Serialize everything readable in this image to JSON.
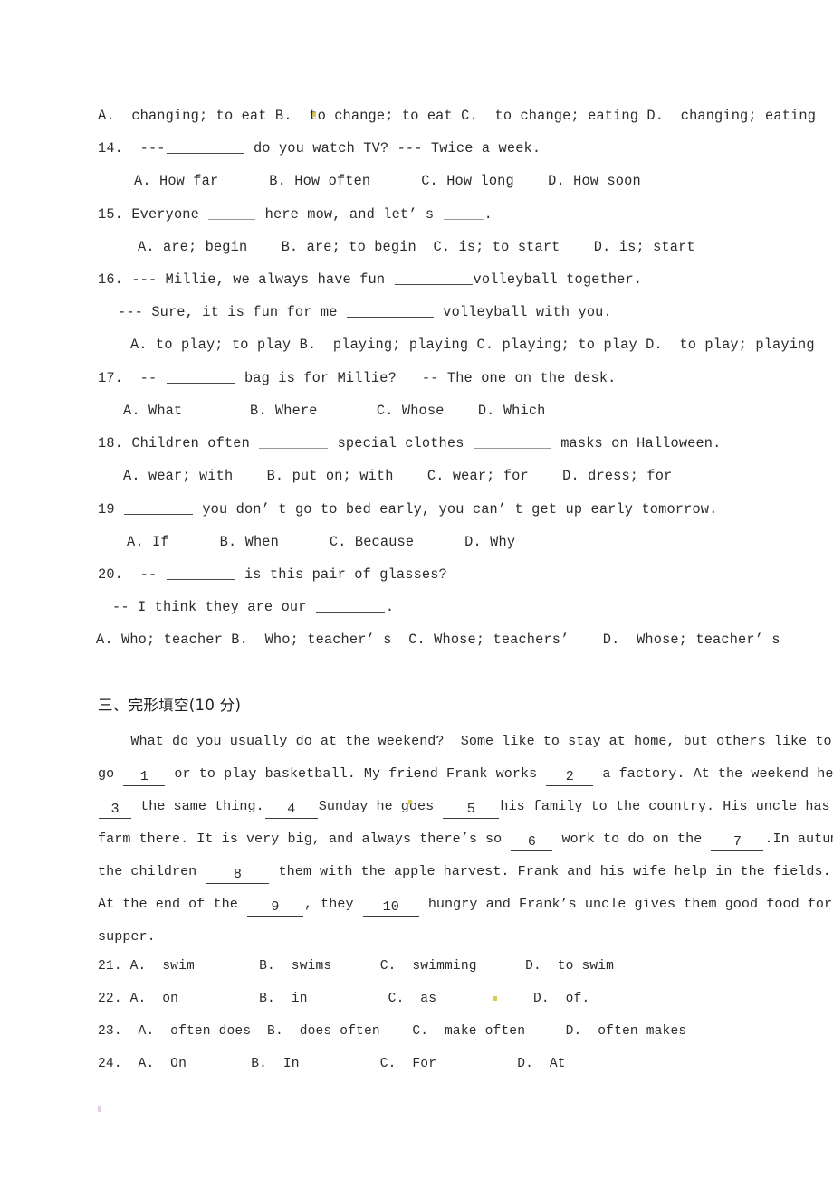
{
  "document": {
    "type": "english-exam-paper",
    "page_background": "#ffffff",
    "text_color": "#2b2b2b"
  },
  "multiple_choice_section": {
    "q13_options_line": "A.  changing; to eat B.  to change; to eat C.  to change; eating D.  changing; eating",
    "questions": [
      {
        "number": "14.",
        "stem_prefix": "14.  ---",
        "stem_suffix": " do you watch TV? --- Twice a week.",
        "options_line": "A. How far      B. How often      C. How long    D. How soon"
      },
      {
        "number": "15.",
        "stem_prefix": "15. Everyone ",
        "stem_middle": " here mow, and let’ s ",
        "stem_suffix": ".",
        "options_line": "A. are; begin    B. are; to begin  C. is; to start    D. is; start"
      },
      {
        "number": "16.",
        "stem_prefix": "16. --- Millie, we always have fun ",
        "stem_suffix": "volleyball together.",
        "stem_line2_prefix": "--- Sure, it is fun for me ",
        "stem_line2_suffix": " volleyball with you.",
        "options_line": "A. to play; to play B.  playing; playing C. playing; to play D.  to play; playing"
      },
      {
        "number": "17.",
        "stem_prefix": "17.  -- ",
        "stem_suffix": " bag is for Millie?   -- The one on the desk.",
        "options_line": "A. What        B. Where       C. Whose    D. Which"
      },
      {
        "number": "18.",
        "stem_prefix": "18. Children often ",
        "stem_middle": " special clothes ",
        "stem_suffix": " masks on Halloween.",
        "options_line": "A. wear; with    B. put on; with    C. wear; for    D. dress; for"
      },
      {
        "number": "19",
        "stem_prefix": "19 ",
        "stem_suffix": " you don’ t go to bed early, you can’ t get up early tomorrow.",
        "options_line": "A. If      B. When      C. Because      D. Why"
      },
      {
        "number": "20.",
        "stem_prefix": "20.  -- ",
        "stem_suffix": " is this pair of glasses?",
        "stem_line2_prefix": "-- I think they are our ",
        "stem_line2_suffix": ".",
        "options_line": "A. Who; teacher B.  Who; teacher’ s  C. Whose; teachers’    D.  Whose; teacher’ s"
      }
    ]
  },
  "cloze_section": {
    "heading": "三、完形填空(10 分)",
    "passage_lines": [
      {
        "parts": [
          {
            "type": "text",
            "value": "    What do you usually do at the weekend?  Some like to stay at home, but others like to"
          }
        ]
      },
      {
        "parts": [
          {
            "type": "text",
            "value": "go "
          },
          {
            "type": "blank",
            "value": "1",
            "size": "n1"
          },
          {
            "type": "text",
            "value": " or to play basketball. My friend Frank works "
          },
          {
            "type": "blank",
            "value": "2",
            "size": "n2"
          },
          {
            "type": "text",
            "value": " a factory. At the weekend he"
          }
        ]
      },
      {
        "parts": [
          {
            "type": "blank",
            "value": "3",
            "size": "n3"
          },
          {
            "type": "text",
            "value": " the same thing."
          },
          {
            "type": "blank",
            "value": "4",
            "size": "n4"
          },
          {
            "type": "text",
            "value": "Sunday he goes "
          },
          {
            "type": "blank",
            "value": "5",
            "size": "n5"
          },
          {
            "type": "text",
            "value": "his family to the country. His uncle has a"
          }
        ]
      },
      {
        "parts": [
          {
            "type": "text",
            "value": "farm there. It is very big, and always there’s so "
          },
          {
            "type": "blank",
            "value": "6",
            "size": "n6"
          },
          {
            "type": "text",
            "value": " work to do on the "
          },
          {
            "type": "blank",
            "value": "7",
            "size": "n7"
          },
          {
            "type": "text",
            "value": ".In autumn,"
          }
        ]
      },
      {
        "parts": [
          {
            "type": "text",
            "value": "the children "
          },
          {
            "type": "blank",
            "value": "8",
            "size": "n8"
          },
          {
            "type": "text",
            "value": " them with the apple harvest. Frank and his wife help in the fields."
          }
        ]
      },
      {
        "parts": [
          {
            "type": "text",
            "value": "At the end of the "
          },
          {
            "type": "blank",
            "value": "9",
            "size": "n9"
          },
          {
            "type": "text",
            "value": ", they "
          },
          {
            "type": "blank",
            "value": "10",
            "size": "n10"
          },
          {
            "type": "text",
            "value": " hungry and Frank’s uncle gives them good food for"
          }
        ]
      },
      {
        "parts": [
          {
            "type": "text",
            "value": "supper."
          }
        ]
      }
    ],
    "answer_options": [
      "21. A.  swim        B.  swims      C.  swimming      D.  to swim",
      "22. A.  on          B.  in          C.  as            D.  of.",
      "23.  A.  often does  B.  does often    C.  make often     D.  often makes",
      "24.  A.  On        B.  In          C.  For          D.  At"
    ]
  }
}
